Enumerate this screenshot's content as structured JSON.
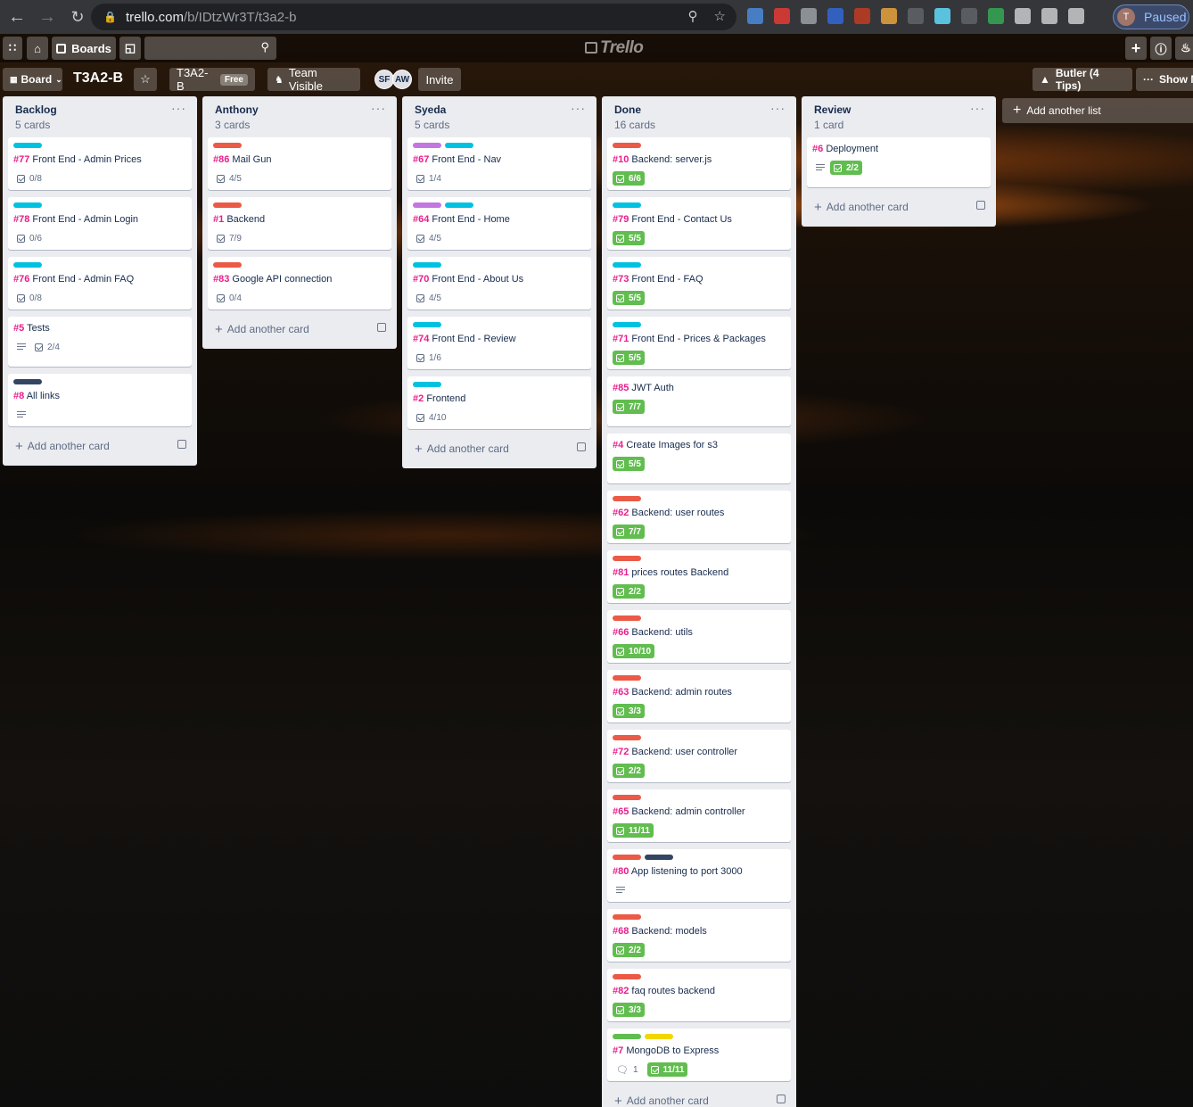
{
  "browser": {
    "url_host": "trello.com",
    "url_path": "/b/IDtzWr3T/t3a2-b",
    "profile_initial": "T",
    "profile_status": "Paused",
    "extensions": [
      "#4a89dc",
      "#e53935",
      "#9aa0a6",
      "#3367d6",
      "#c23b22",
      "#e8a33d",
      "#5f6368",
      "#61dafb",
      "#5f6368",
      "#34a853",
      "#c9cacc",
      "#c9cacc",
      "#c9cacc"
    ]
  },
  "header": {
    "boards_label": "Boards",
    "logo": "Trello"
  },
  "board": {
    "view_label": "Board",
    "title": "T3A2-B",
    "team_name": "T3A2-B",
    "team_badge": "Free",
    "visibility": "Team Visible",
    "members": [
      "SF",
      "AW"
    ],
    "invite_label": "Invite",
    "butler_label": "Butler (4 Tips)",
    "show_menu_label": "Show M"
  },
  "add_list_label": "Add another list",
  "add_card_label": "Add another card",
  "lists": [
    {
      "title": "Backlog",
      "count": "5 cards",
      "cards": [
        {
          "labels": [
            "sky"
          ],
          "num": "#77",
          "title": "Front End - Admin Prices",
          "desc": false,
          "checklist": "0/8",
          "complete": false
        },
        {
          "labels": [
            "sky"
          ],
          "num": "#78",
          "title": "Front End - Admin Login",
          "desc": false,
          "checklist": "0/6",
          "complete": false
        },
        {
          "labels": [
            "sky"
          ],
          "num": "#76",
          "title": "Front End - Admin FAQ",
          "desc": false,
          "checklist": "0/8",
          "complete": false
        },
        {
          "labels": [],
          "num": "#5",
          "title": "Tests",
          "desc": true,
          "checklist": "2/4",
          "complete": false
        },
        {
          "labels": [
            "black"
          ],
          "num": "#8",
          "title": "All links",
          "desc": true,
          "checklist": null,
          "complete": false
        }
      ]
    },
    {
      "title": "Anthony",
      "count": "3 cards",
      "cards": [
        {
          "labels": [
            "red"
          ],
          "num": "#86",
          "title": "Mail Gun",
          "desc": false,
          "checklist": "4/5",
          "complete": false
        },
        {
          "labels": [
            "red"
          ],
          "num": "#1",
          "title": "Backend",
          "desc": false,
          "checklist": "7/9",
          "complete": false
        },
        {
          "labels": [
            "red"
          ],
          "num": "#83",
          "title": "Google API connection",
          "desc": false,
          "checklist": "0/4",
          "complete": false
        }
      ]
    },
    {
      "title": "Syeda",
      "count": "5 cards",
      "cards": [
        {
          "labels": [
            "purple",
            "sky"
          ],
          "num": "#67",
          "title": "Front End - Nav",
          "desc": false,
          "checklist": "1/4",
          "complete": false
        },
        {
          "labels": [
            "purple",
            "sky"
          ],
          "num": "#64",
          "title": "Front End - Home",
          "desc": false,
          "checklist": "4/5",
          "complete": false
        },
        {
          "labels": [
            "sky"
          ],
          "num": "#70",
          "title": "Front End - About Us",
          "desc": false,
          "checklist": "4/5",
          "complete": false
        },
        {
          "labels": [
            "sky"
          ],
          "num": "#74",
          "title": "Front End - Review",
          "desc": false,
          "checklist": "1/6",
          "complete": false
        },
        {
          "labels": [
            "sky"
          ],
          "num": "#2",
          "title": "Frontend",
          "desc": false,
          "checklist": "4/10",
          "complete": false
        }
      ]
    },
    {
      "title": "Done",
      "count": "16 cards",
      "cards": [
        {
          "labels": [
            "red"
          ],
          "num": "#10",
          "title": "Backend: server.js",
          "desc": false,
          "checklist": "6/6",
          "complete": true
        },
        {
          "labels": [
            "sky"
          ],
          "num": "#79",
          "title": "Front End - Contact Us",
          "desc": false,
          "checklist": "5/5",
          "complete": true
        },
        {
          "labels": [
            "sky"
          ],
          "num": "#73",
          "title": "Front End - FAQ",
          "desc": false,
          "checklist": "5/5",
          "complete": true
        },
        {
          "labels": [
            "sky"
          ],
          "num": "#71",
          "title": "Front End - Prices & Packages",
          "desc": false,
          "checklist": "5/5",
          "complete": true
        },
        {
          "labels": [],
          "num": "#85",
          "title": "JWT Auth",
          "desc": false,
          "checklist": "7/7",
          "complete": true
        },
        {
          "labels": [],
          "num": "#4",
          "title": "Create Images for s3",
          "desc": false,
          "checklist": "5/5",
          "complete": true
        },
        {
          "labels": [
            "red"
          ],
          "num": "#62",
          "title": "Backend: user routes",
          "desc": false,
          "checklist": "7/7",
          "complete": true
        },
        {
          "labels": [
            "red"
          ],
          "num": "#81",
          "title": "prices routes Backend",
          "desc": false,
          "checklist": "2/2",
          "complete": true
        },
        {
          "labels": [
            "red"
          ],
          "num": "#66",
          "title": "Backend: utils",
          "desc": false,
          "checklist": "10/10",
          "complete": true
        },
        {
          "labels": [
            "red"
          ],
          "num": "#63",
          "title": "Backend: admin routes",
          "desc": false,
          "checklist": "3/3",
          "complete": true
        },
        {
          "labels": [
            "red"
          ],
          "num": "#72",
          "title": "Backend: user controller",
          "desc": false,
          "checklist": "2/2",
          "complete": true
        },
        {
          "labels": [
            "red"
          ],
          "num": "#65",
          "title": "Backend: admin controller",
          "desc": false,
          "checklist": "11/11",
          "complete": true
        },
        {
          "labels": [
            "red",
            "black"
          ],
          "num": "#80",
          "title": "App listening to port 3000",
          "desc": true,
          "checklist": null,
          "complete": false
        },
        {
          "labels": [
            "red"
          ],
          "num": "#68",
          "title": "Backend: models",
          "desc": false,
          "checklist": "2/2",
          "complete": true
        },
        {
          "labels": [
            "red"
          ],
          "num": "#82",
          "title": "faq routes backend",
          "desc": false,
          "checklist": "3/3",
          "complete": true
        },
        {
          "labels": [
            "green",
            "yellow"
          ],
          "num": "#7",
          "title": "MongoDB to Express",
          "desc": false,
          "comments": "1",
          "checklist": "11/11",
          "complete": true
        }
      ]
    },
    {
      "title": "Review",
      "count": "1 card",
      "cards": [
        {
          "labels": [],
          "num": "#6",
          "title": "Deployment",
          "desc": true,
          "checklist": "2/2",
          "complete": true
        }
      ]
    }
  ]
}
